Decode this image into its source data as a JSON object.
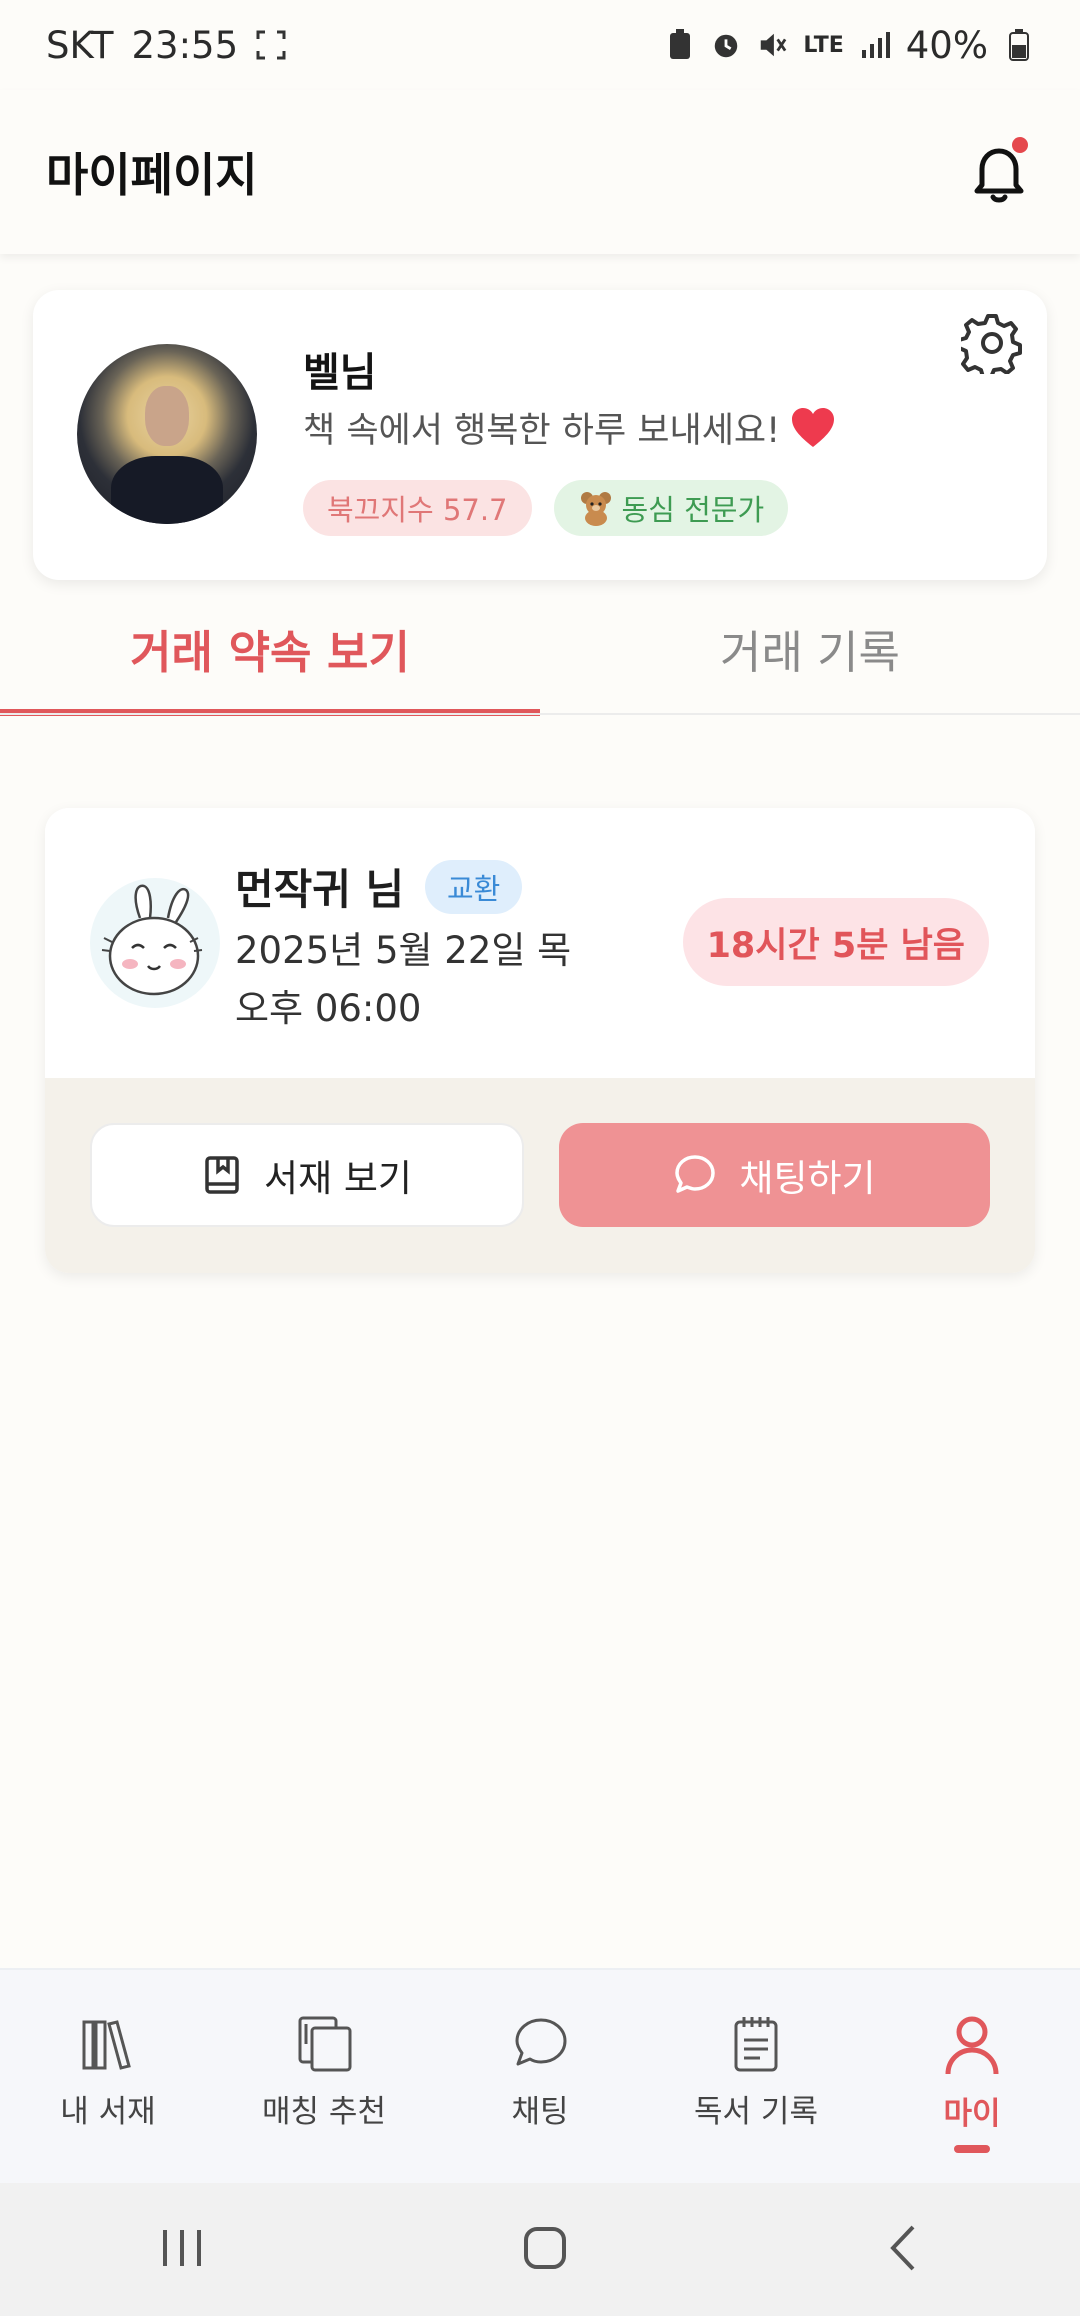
{
  "status_bar": {
    "carrier": "SKT",
    "time": "23:55",
    "network": "LTE",
    "battery": "40%"
  },
  "header": {
    "title": "마이페이지"
  },
  "profile": {
    "name": "벨님",
    "bio": "책 속에서 행복한 하루 보내세요!",
    "badges": {
      "index": "북끄지수 57.7",
      "expert": "동심 전문가"
    }
  },
  "tabs": [
    {
      "label": "거래 약속 보기",
      "active": true
    },
    {
      "label": "거래 기록",
      "active": false
    }
  ],
  "trade": {
    "partner_name": "먼작귀 님",
    "type_badge": "교환",
    "date": "2025년 5월 22일 목",
    "time": "오후 06:00",
    "time_left": "18시간 5분 남음",
    "shelf_button": "서재 보기",
    "chat_button": "채팅하기"
  },
  "bottom_nav": [
    {
      "label": "내 서재",
      "icon": "books-icon"
    },
    {
      "label": "매칭 추천",
      "icon": "book-match-icon"
    },
    {
      "label": "채팅",
      "icon": "chat-bubble-icon"
    },
    {
      "label": "독서 기록",
      "icon": "notepad-icon"
    },
    {
      "label": "마이",
      "icon": "person-icon",
      "active": true
    }
  ],
  "colors": {
    "accent": "#e0575b",
    "chat_button": "#ef9294",
    "background": "#fdfcf9"
  }
}
